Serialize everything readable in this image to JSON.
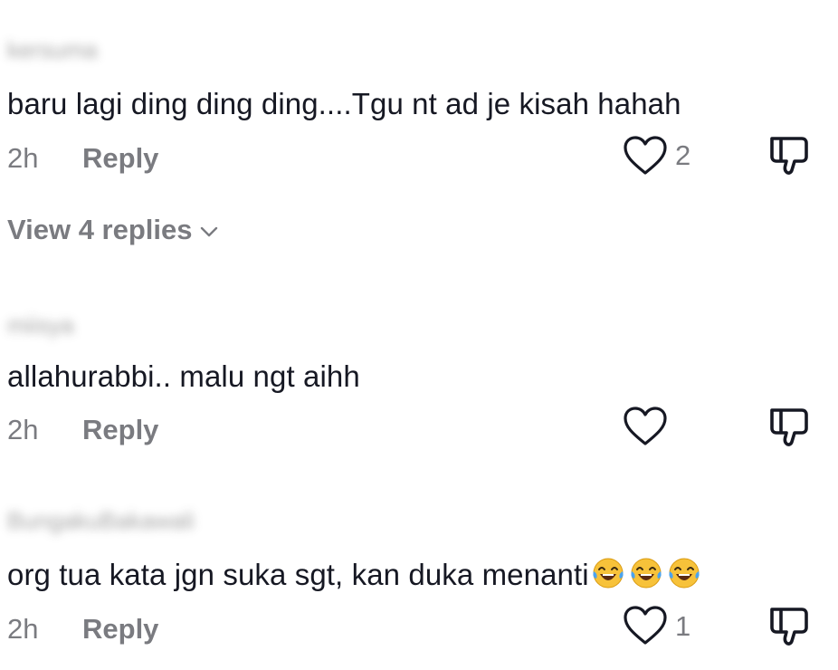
{
  "comments": [
    {
      "username": "kersuma",
      "text": "baru lagi ding ding ding....Tgu nt ad je kisah hahah",
      "time": "2h",
      "reply_label": "Reply",
      "like_count": "2",
      "view_replies_label": "View 4 replies"
    },
    {
      "username": "miisya",
      "text": "allahurabbi.. malu ngt aihh",
      "time": "2h",
      "reply_label": "Reply",
      "like_count": ""
    },
    {
      "username": "BungakuBakawali",
      "text": "org tua kata jgn suka sgt, kan duka menanti",
      "emoji": "😂😂😂",
      "time": "2h",
      "reply_label": "Reply",
      "like_count": "1"
    }
  ],
  "icons": {
    "like": "heart-outline-icon",
    "dislike": "thumbs-down-icon",
    "chevron": "chevron-down-icon",
    "emoji": "face-with-tears-of-joy"
  },
  "colors": {
    "text": "#161823",
    "muted": "#7a7b80",
    "icon": "#161823"
  }
}
